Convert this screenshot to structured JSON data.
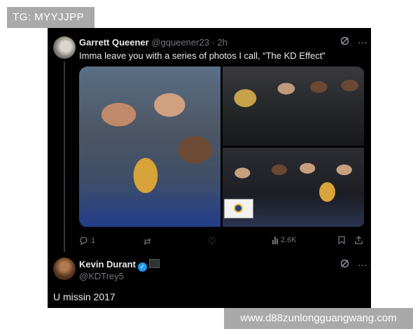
{
  "watermarks": {
    "top": "TG: MYYJJPP",
    "bottom": "www.d88zunlongguangwang.com"
  },
  "tweet": {
    "display_name": "Garrett Queener",
    "handle": "@gqueener23",
    "time": "· 2h",
    "text": "Imma leave you with a series of photos I call, “The KD Effect”",
    "top_icons": [
      "grok-icon",
      "more-icon"
    ],
    "photos": [
      "champions-celebration-photo",
      "trophy-celebration-photo",
      "team-trophy-photo"
    ],
    "actions": {
      "reply_count": "1",
      "retweet_count": "",
      "like_count": "",
      "views_count": "2.6K"
    }
  },
  "reply": {
    "display_name": "Kevin Durant",
    "handle": "@KDTrey5",
    "text": "U missin 2017",
    "verified_color": "#1d9bf0"
  },
  "colors": {
    "background": "#000000",
    "text": "#e7e9ea",
    "muted": "#71767b",
    "verified": "#1d9bf0"
  }
}
